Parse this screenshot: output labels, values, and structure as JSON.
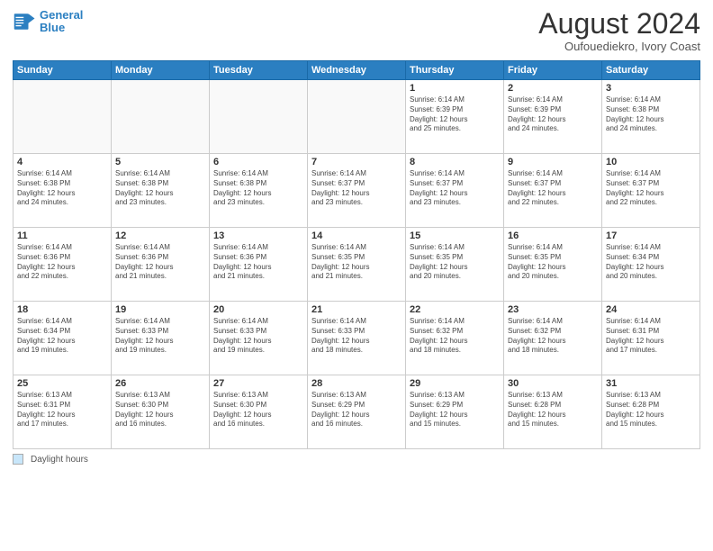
{
  "logo": {
    "line1": "General",
    "line2": "Blue"
  },
  "title": "August 2024",
  "location": "Oufouediekro, Ivory Coast",
  "days_of_week": [
    "Sunday",
    "Monday",
    "Tuesday",
    "Wednesday",
    "Thursday",
    "Friday",
    "Saturday"
  ],
  "footer": {
    "label": "Daylight hours"
  },
  "weeks": [
    [
      {
        "day": "",
        "info": ""
      },
      {
        "day": "",
        "info": ""
      },
      {
        "day": "",
        "info": ""
      },
      {
        "day": "",
        "info": ""
      },
      {
        "day": "1",
        "info": "Sunrise: 6:14 AM\nSunset: 6:39 PM\nDaylight: 12 hours\nand 25 minutes."
      },
      {
        "day": "2",
        "info": "Sunrise: 6:14 AM\nSunset: 6:39 PM\nDaylight: 12 hours\nand 24 minutes."
      },
      {
        "day": "3",
        "info": "Sunrise: 6:14 AM\nSunset: 6:38 PM\nDaylight: 12 hours\nand 24 minutes."
      }
    ],
    [
      {
        "day": "4",
        "info": "Sunrise: 6:14 AM\nSunset: 6:38 PM\nDaylight: 12 hours\nand 24 minutes."
      },
      {
        "day": "5",
        "info": "Sunrise: 6:14 AM\nSunset: 6:38 PM\nDaylight: 12 hours\nand 23 minutes."
      },
      {
        "day": "6",
        "info": "Sunrise: 6:14 AM\nSunset: 6:38 PM\nDaylight: 12 hours\nand 23 minutes."
      },
      {
        "day": "7",
        "info": "Sunrise: 6:14 AM\nSunset: 6:37 PM\nDaylight: 12 hours\nand 23 minutes."
      },
      {
        "day": "8",
        "info": "Sunrise: 6:14 AM\nSunset: 6:37 PM\nDaylight: 12 hours\nand 23 minutes."
      },
      {
        "day": "9",
        "info": "Sunrise: 6:14 AM\nSunset: 6:37 PM\nDaylight: 12 hours\nand 22 minutes."
      },
      {
        "day": "10",
        "info": "Sunrise: 6:14 AM\nSunset: 6:37 PM\nDaylight: 12 hours\nand 22 minutes."
      }
    ],
    [
      {
        "day": "11",
        "info": "Sunrise: 6:14 AM\nSunset: 6:36 PM\nDaylight: 12 hours\nand 22 minutes."
      },
      {
        "day": "12",
        "info": "Sunrise: 6:14 AM\nSunset: 6:36 PM\nDaylight: 12 hours\nand 21 minutes."
      },
      {
        "day": "13",
        "info": "Sunrise: 6:14 AM\nSunset: 6:36 PM\nDaylight: 12 hours\nand 21 minutes."
      },
      {
        "day": "14",
        "info": "Sunrise: 6:14 AM\nSunset: 6:35 PM\nDaylight: 12 hours\nand 21 minutes."
      },
      {
        "day": "15",
        "info": "Sunrise: 6:14 AM\nSunset: 6:35 PM\nDaylight: 12 hours\nand 20 minutes."
      },
      {
        "day": "16",
        "info": "Sunrise: 6:14 AM\nSunset: 6:35 PM\nDaylight: 12 hours\nand 20 minutes."
      },
      {
        "day": "17",
        "info": "Sunrise: 6:14 AM\nSunset: 6:34 PM\nDaylight: 12 hours\nand 20 minutes."
      }
    ],
    [
      {
        "day": "18",
        "info": "Sunrise: 6:14 AM\nSunset: 6:34 PM\nDaylight: 12 hours\nand 19 minutes."
      },
      {
        "day": "19",
        "info": "Sunrise: 6:14 AM\nSunset: 6:33 PM\nDaylight: 12 hours\nand 19 minutes."
      },
      {
        "day": "20",
        "info": "Sunrise: 6:14 AM\nSunset: 6:33 PM\nDaylight: 12 hours\nand 19 minutes."
      },
      {
        "day": "21",
        "info": "Sunrise: 6:14 AM\nSunset: 6:33 PM\nDaylight: 12 hours\nand 18 minutes."
      },
      {
        "day": "22",
        "info": "Sunrise: 6:14 AM\nSunset: 6:32 PM\nDaylight: 12 hours\nand 18 minutes."
      },
      {
        "day": "23",
        "info": "Sunrise: 6:14 AM\nSunset: 6:32 PM\nDaylight: 12 hours\nand 18 minutes."
      },
      {
        "day": "24",
        "info": "Sunrise: 6:14 AM\nSunset: 6:31 PM\nDaylight: 12 hours\nand 17 minutes."
      }
    ],
    [
      {
        "day": "25",
        "info": "Sunrise: 6:13 AM\nSunset: 6:31 PM\nDaylight: 12 hours\nand 17 minutes."
      },
      {
        "day": "26",
        "info": "Sunrise: 6:13 AM\nSunset: 6:30 PM\nDaylight: 12 hours\nand 16 minutes."
      },
      {
        "day": "27",
        "info": "Sunrise: 6:13 AM\nSunset: 6:30 PM\nDaylight: 12 hours\nand 16 minutes."
      },
      {
        "day": "28",
        "info": "Sunrise: 6:13 AM\nSunset: 6:29 PM\nDaylight: 12 hours\nand 16 minutes."
      },
      {
        "day": "29",
        "info": "Sunrise: 6:13 AM\nSunset: 6:29 PM\nDaylight: 12 hours\nand 15 minutes."
      },
      {
        "day": "30",
        "info": "Sunrise: 6:13 AM\nSunset: 6:28 PM\nDaylight: 12 hours\nand 15 minutes."
      },
      {
        "day": "31",
        "info": "Sunrise: 6:13 AM\nSunset: 6:28 PM\nDaylight: 12 hours\nand 15 minutes."
      }
    ]
  ]
}
